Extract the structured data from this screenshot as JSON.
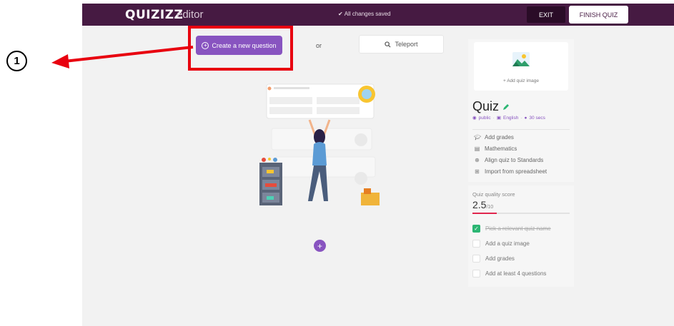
{
  "app": {
    "logo": "QUIZIZZ",
    "logo_sub": "editor",
    "save_status": "All changes saved",
    "exit_label": "EXIT",
    "finish_label": "FINISH QUIZ"
  },
  "actions": {
    "create_label": "Create a new question",
    "or_label": "or",
    "teleport_label": "Teleport"
  },
  "quiz": {
    "add_image_label": "+ Add quiz image",
    "title": "Quiz",
    "visibility": "public",
    "language": "English",
    "timer": "30 secs",
    "menu": [
      {
        "icon": "graduation-cap-icon",
        "label": "Add grades"
      },
      {
        "icon": "book-icon",
        "label": "Mathematics"
      },
      {
        "icon": "target-icon",
        "label": "Align quiz to Standards"
      },
      {
        "icon": "spreadsheet-icon",
        "label": "Import from spreadsheet"
      }
    ]
  },
  "quality": {
    "label": "Quiz quality score",
    "score": "2.5",
    "denominator": "/10",
    "score_fraction": 0.25,
    "tasks": [
      {
        "label": "Pick a relevant quiz name",
        "done": true
      },
      {
        "label": "Add a quiz image",
        "done": false
      },
      {
        "label": "Add grades",
        "done": false
      },
      {
        "label": "Add at least 4 questions",
        "done": false
      }
    ]
  },
  "annotation": {
    "step": "1"
  },
  "colors": {
    "topbar": "#461a42",
    "accent": "#8854c0",
    "annotation_red": "#e8000f",
    "score_red": "#e0264e",
    "task_done_green": "#2bb673"
  }
}
